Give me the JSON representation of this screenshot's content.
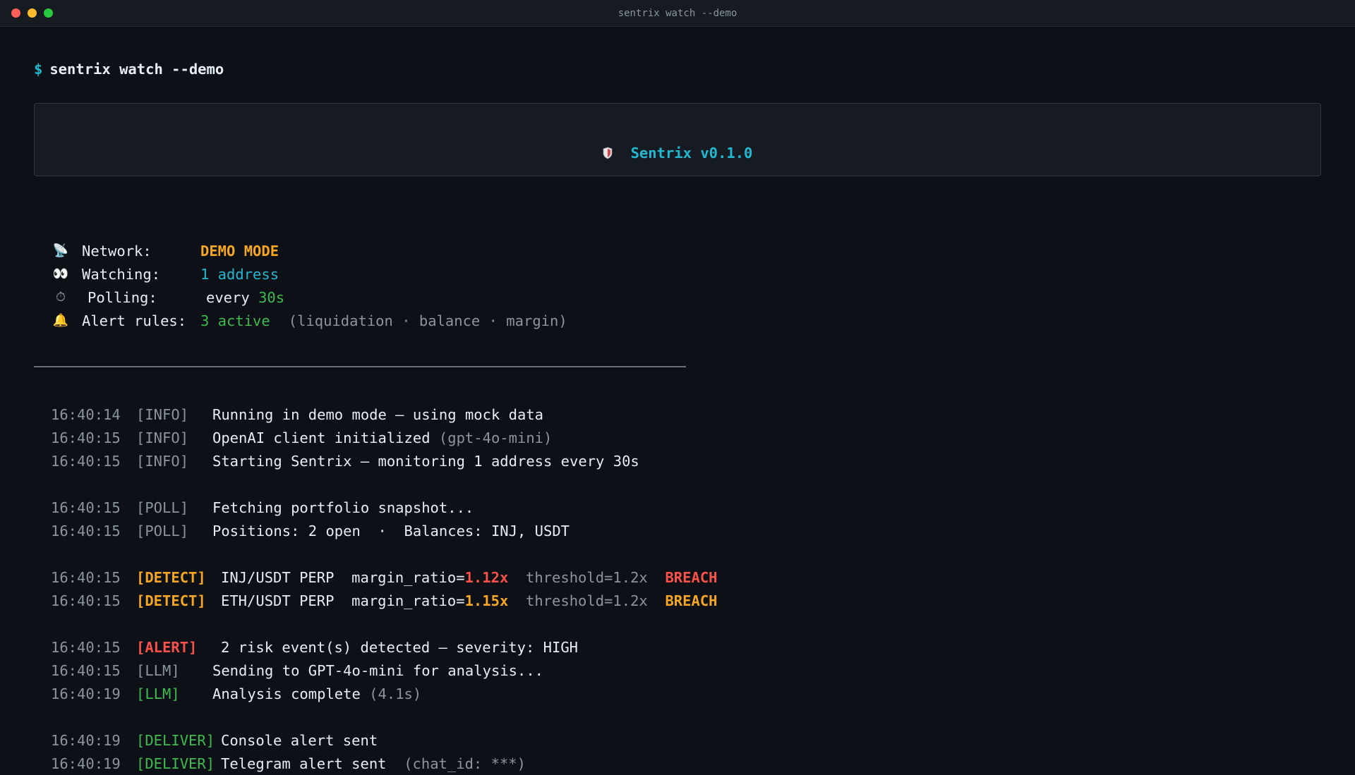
{
  "window": {
    "title": "sentrix watch --demo"
  },
  "prompt": {
    "symbol": "$",
    "command": "sentrix watch --demo"
  },
  "banner": {
    "title": "Sentrix v0.1.0",
    "icon": "shield-icon"
  },
  "status": {
    "network": {
      "icon": "satellite-dish-icon",
      "label": "Network:",
      "value": "DEMO MODE"
    },
    "watching": {
      "icon": "eyes-icon",
      "label": "Watching:",
      "value": "1 address"
    },
    "polling": {
      "icon": "stopwatch-icon",
      "label": "Polling:",
      "prefix": "every ",
      "value": "30s"
    },
    "alert_rules": {
      "icon": "bell-icon",
      "label": "Alert rules:",
      "value": "3 active",
      "detail": "(liquidation · balance · margin)"
    }
  },
  "logs": {
    "l1": {
      "ts": "16:40:14",
      "tag": "[INFO]",
      "msg": "Running in demo mode — using mock data"
    },
    "l2": {
      "ts": "16:40:15",
      "tag": "[INFO]",
      "msg": "OpenAI client initialized ",
      "note": "(gpt-4o-mini)"
    },
    "l3": {
      "ts": "16:40:15",
      "tag": "[INFO]",
      "msg": "Starting Sentrix — monitoring 1 address every 30s"
    },
    "l4": {
      "ts": "16:40:15",
      "tag": "[POLL]",
      "msg": "Fetching portfolio snapshot..."
    },
    "l5": {
      "ts": "16:40:15",
      "tag": "[POLL]",
      "msg": "Positions: 2 open  ·  Balances: INJ, USDT"
    },
    "l6": {
      "ts": "16:40:15",
      "tag": "[DETECT]",
      "market": "INJ/USDT PERP  margin_ratio=",
      "ratio": "1.12x",
      "threshold": "  threshold=1.2x  ",
      "status": "BREACH"
    },
    "l7": {
      "ts": "16:40:15",
      "tag": "[DETECT]",
      "market": "ETH/USDT PERP  margin_ratio=",
      "ratio": "1.15x",
      "threshold": "  threshold=1.2x  ",
      "status": "BREACH"
    },
    "l8": {
      "ts": "16:40:15",
      "tag": "[ALERT]",
      "msg": "2 risk event(s) detected — severity: HIGH"
    },
    "l9": {
      "ts": "16:40:15",
      "tag": "[LLM]",
      "msg": "Sending to GPT-4o-mini for analysis..."
    },
    "l10": {
      "ts": "16:40:19",
      "tag": "[LLM]",
      "msg": "Analysis complete ",
      "note": "(4.1s)"
    },
    "l11": {
      "ts": "16:40:19",
      "tag": "[DELIVER]",
      "msg": "Console alert sent"
    },
    "l12": {
      "ts": "16:40:19",
      "tag": "[DELIVER]",
      "msg": "Telegram alert sent  ",
      "note": "(chat_id: ***)"
    }
  }
}
